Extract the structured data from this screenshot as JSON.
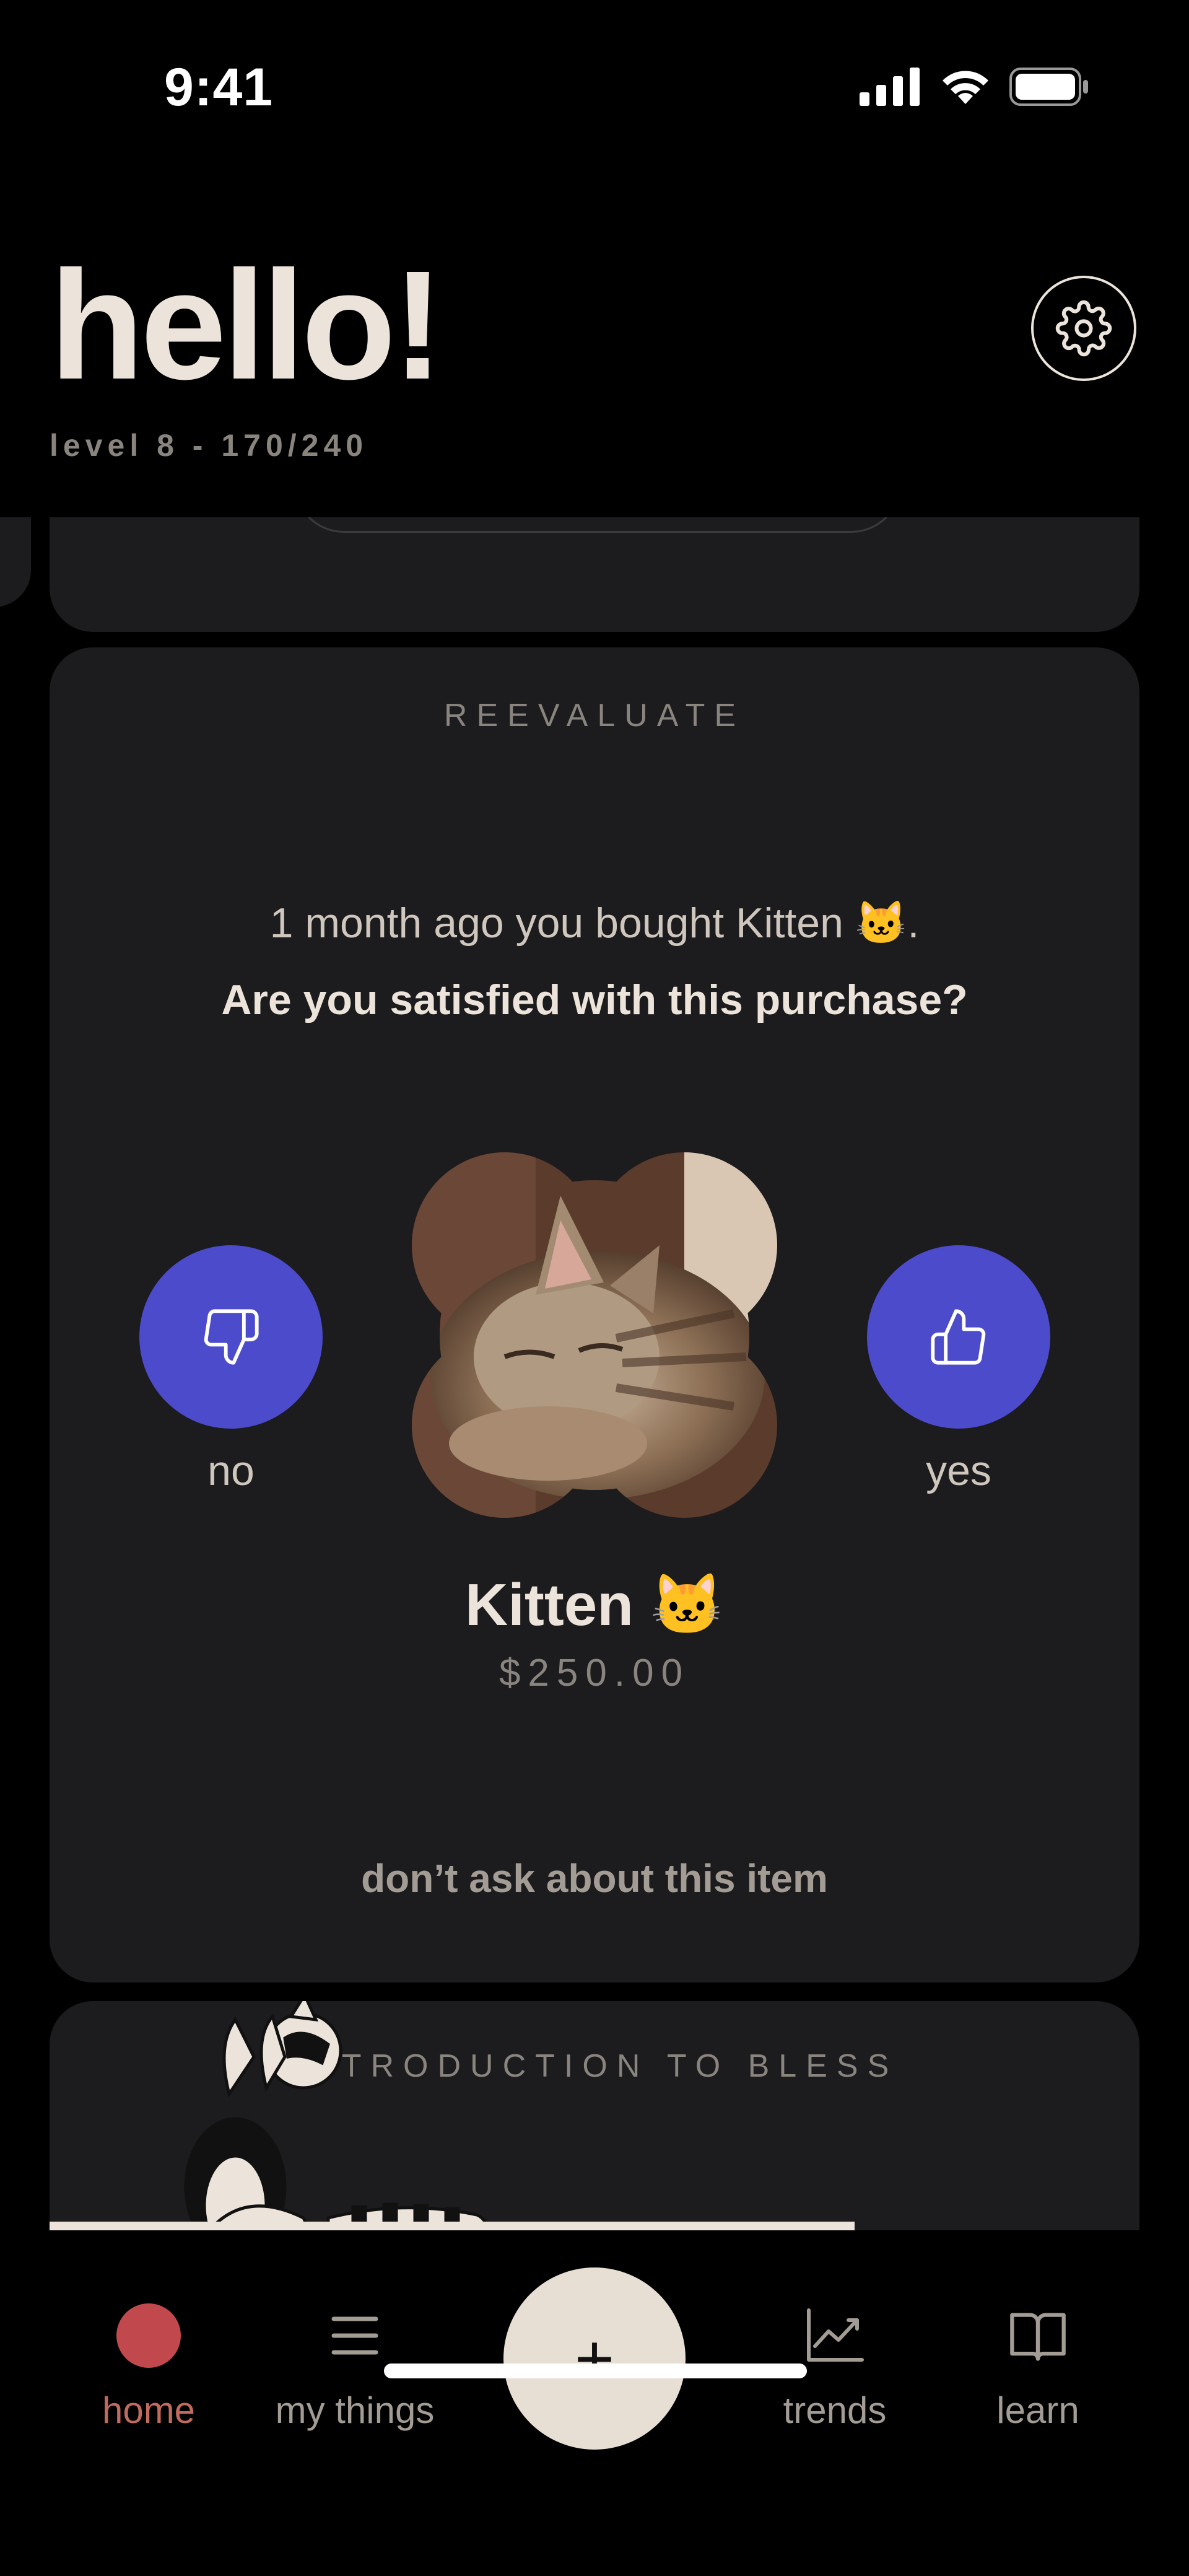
{
  "status_bar": {
    "time": "9:41"
  },
  "header": {
    "greeting": "hello!",
    "level": "level 8 - 170/240"
  },
  "reevaluate": {
    "section_label": "REEVALUATE",
    "prompt_line": "1 month ago you bought Kitten 🐱.",
    "question": "Are you satisfied with this purchase?",
    "no_label": "no",
    "yes_label": "yes",
    "item_name": "Kitten 🐱",
    "item_price": "$250.00",
    "dont_ask_label": "don’t ask about this item"
  },
  "intro": {
    "section_label": "INTRODUCTION TO BLESS"
  },
  "tabbar": {
    "home": "home",
    "my_things": "my things",
    "add": "+",
    "trends": "trends",
    "learn": "learn"
  },
  "colors": {
    "accent_blue": "#4b4bcb",
    "home_red": "#c1494d",
    "cream": "#ece4da",
    "card_bg": "#1c1b1d"
  }
}
